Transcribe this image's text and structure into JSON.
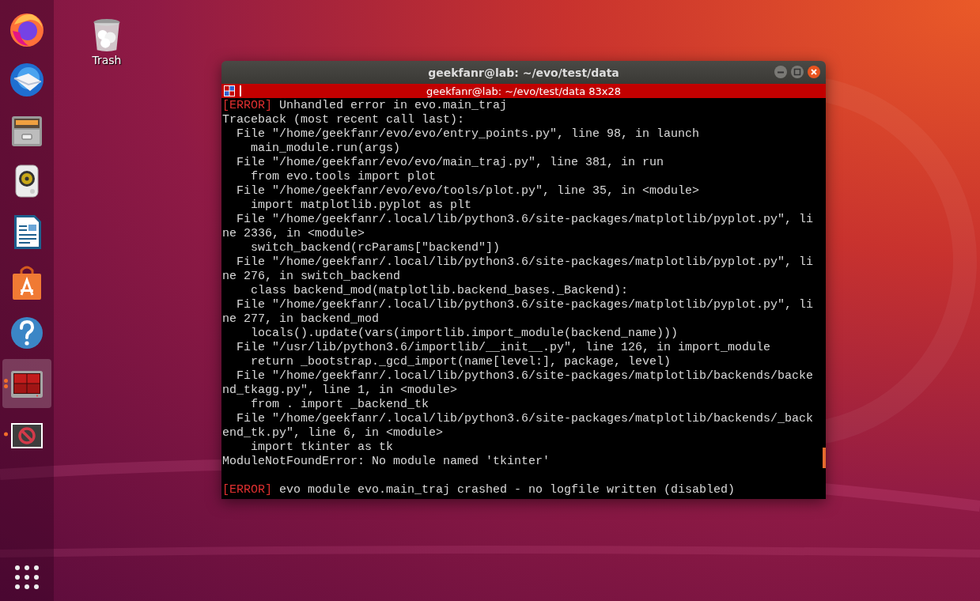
{
  "dock": {
    "items": [
      {
        "kind": "firefox",
        "running": false,
        "selected": false
      },
      {
        "kind": "mail",
        "running": false,
        "selected": false
      },
      {
        "kind": "files",
        "running": false,
        "selected": false
      },
      {
        "kind": "music",
        "running": false,
        "selected": false
      },
      {
        "kind": "writer",
        "running": false,
        "selected": false
      },
      {
        "kind": "software",
        "running": false,
        "selected": false
      },
      {
        "kind": "help",
        "running": false,
        "selected": false
      },
      {
        "kind": "terminal",
        "running": true,
        "multiple_windows": true,
        "selected": true
      },
      {
        "kind": "blocked",
        "running": true,
        "multiple_windows": false,
        "selected": false
      }
    ]
  },
  "desktop_icons": [
    {
      "kind": "trash",
      "label": "Trash"
    }
  ],
  "window": {
    "title": "geekfanr@lab: ~/evo/test/data",
    "tab_title": "geekfanr@lab: ~/evo/test/data 83x28",
    "lines": [
      {
        "kind": "error",
        "tag": "[ERROR]",
        "text": "Unhandled error in evo.main_traj"
      },
      {
        "kind": "plain",
        "text": "Traceback (most recent call last):"
      },
      {
        "kind": "plain",
        "text": "  File \"/home/geekfanr/evo/evo/entry_points.py\", line 98, in launch"
      },
      {
        "kind": "plain",
        "text": "    main_module.run(args)"
      },
      {
        "kind": "plain",
        "text": "  File \"/home/geekfanr/evo/evo/main_traj.py\", line 381, in run"
      },
      {
        "kind": "plain",
        "text": "    from evo.tools import plot"
      },
      {
        "kind": "plain",
        "text": "  File \"/home/geekfanr/evo/evo/tools/plot.py\", line 35, in <module>"
      },
      {
        "kind": "plain",
        "text": "    import matplotlib.pyplot as plt"
      },
      {
        "kind": "plain",
        "text": "  File \"/home/geekfanr/.local/lib/python3.6/site-packages/matplotlib/pyplot.py\", li"
      },
      {
        "kind": "plain",
        "text": "ne 2336, in <module>"
      },
      {
        "kind": "plain",
        "text": "    switch_backend(rcParams[\"backend\"])"
      },
      {
        "kind": "plain",
        "text": "  File \"/home/geekfanr/.local/lib/python3.6/site-packages/matplotlib/pyplot.py\", li"
      },
      {
        "kind": "plain",
        "text": "ne 276, in switch_backend"
      },
      {
        "kind": "plain",
        "text": "    class backend_mod(matplotlib.backend_bases._Backend):"
      },
      {
        "kind": "plain",
        "text": "  File \"/home/geekfanr/.local/lib/python3.6/site-packages/matplotlib/pyplot.py\", li"
      },
      {
        "kind": "plain",
        "text": "ne 277, in backend_mod"
      },
      {
        "kind": "plain",
        "text": "    locals().update(vars(importlib.import_module(backend_name)))"
      },
      {
        "kind": "plain",
        "text": "  File \"/usr/lib/python3.6/importlib/__init__.py\", line 126, in import_module"
      },
      {
        "kind": "plain",
        "text": "    return _bootstrap._gcd_import(name[level:], package, level)"
      },
      {
        "kind": "plain",
        "text": "  File \"/home/geekfanr/.local/lib/python3.6/site-packages/matplotlib/backends/backe"
      },
      {
        "kind": "plain",
        "text": "nd_tkagg.py\", line 1, in <module>"
      },
      {
        "kind": "plain",
        "text": "    from . import _backend_tk"
      },
      {
        "kind": "plain",
        "text": "  File \"/home/geekfanr/.local/lib/python3.6/site-packages/matplotlib/backends/_back"
      },
      {
        "kind": "plain",
        "text": "end_tk.py\", line 6, in <module>"
      },
      {
        "kind": "plain",
        "text": "    import tkinter as tk"
      },
      {
        "kind": "plain",
        "text": "ModuleNotFoundError: No module named 'tkinter'"
      },
      {
        "kind": "blank"
      },
      {
        "kind": "error",
        "tag": "[ERROR]",
        "text": "evo module evo.main_traj crashed - no logfile written (disabled)"
      }
    ]
  }
}
